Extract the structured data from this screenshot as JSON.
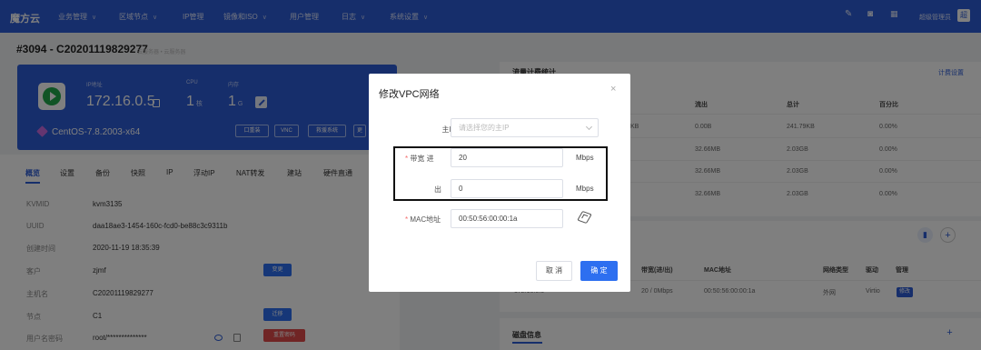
{
  "nav": {
    "brand": "魔方云",
    "items": [
      {
        "label": "业务管理",
        "caret": true
      },
      {
        "label": "区域节点",
        "caret": true
      },
      {
        "label": "IP管理",
        "caret": false
      },
      {
        "label": "镜像和ISO",
        "caret": true
      },
      {
        "label": "用户管理",
        "caret": false
      },
      {
        "label": "日志",
        "caret": true
      },
      {
        "label": "系统设置",
        "caret": true
      }
    ],
    "user": "超级管理员",
    "user_short": "超"
  },
  "page": {
    "title": "#3094 - C20201119829277",
    "crumb": "云服务器 • 云服务器"
  },
  "host_card": {
    "ip_label": "IP地址",
    "ip_value": "172.16.0.5",
    "cpu_label": "CPU",
    "cpu_value": "1",
    "cpu_unit": "核",
    "mem_label": "内存",
    "mem_value": "1",
    "mem_unit": "G",
    "os": "CentOS-7.8.2003-x64",
    "buttons": [
      "口重装",
      "VNC",
      "救援系统",
      "更"
    ]
  },
  "tabs": [
    "概览",
    "设置",
    "备份",
    "快照",
    "IP",
    "浮动IP",
    "NAT转发",
    "建站",
    "硬件直通"
  ],
  "info_rows": [
    {
      "label": "KVMID",
      "value": "kvm3135"
    },
    {
      "label": "UUID",
      "value": "daa18ae3-1454-160c-fcd0-be88c3c9311b"
    },
    {
      "label": "创建时间",
      "value": "2020-11-19 18:35:39"
    },
    {
      "label": "客户",
      "value": "zjmf"
    },
    {
      "label": "主机名",
      "value": "C20201119829277"
    },
    {
      "label": "节点",
      "value": "C1"
    },
    {
      "label": "用户名密码",
      "value": "root/**************"
    }
  ],
  "info_buttons": {
    "change": "变更",
    "migrate": "迁移",
    "reset_pw": "重置密码"
  },
  "traffic": {
    "title": "流量计费统计",
    "link": "计费设置",
    "headers": [
      "流出",
      "总计",
      "百分比"
    ],
    "partial_first": "KB",
    "rows": [
      {
        "out": "0.00B",
        "total": "241.79KB",
        "pct": "0.00%"
      },
      {
        "out": "32.66MB",
        "total": "2.03GB",
        "pct": "0.00%"
      },
      {
        "out": "32.66MB",
        "total": "2.03GB",
        "pct": "0.00%"
      },
      {
        "out": "32.66MB",
        "total": "2.03GB",
        "pct": "0.00%"
      }
    ]
  },
  "network": {
    "headers": [
      "带宽(进/出)",
      "MAC地址",
      "网络类型",
      "驱动",
      "管理"
    ],
    "row": {
      "ip": "172.16.0.5",
      "bw": "20 / 0Mbps",
      "mac": "00:50:56:00:00:1a",
      "type": "外网",
      "driver": "Virtio",
      "action": "修改"
    }
  },
  "disk": {
    "title": "磁盘信息"
  },
  "modal": {
    "title": "修改VPC网络",
    "main_ip_label": "主IP",
    "main_ip_placeholder": "请选择您的主IP",
    "bandwidth_label": "带宽",
    "in_label": "进",
    "in_value": "20",
    "out_label": "出",
    "out_value": "0",
    "unit": "Mbps",
    "mac_label": "MAC地址",
    "mac_value": "00:50:56:00:00:1a",
    "cancel": "取 消",
    "ok": "确 定"
  }
}
